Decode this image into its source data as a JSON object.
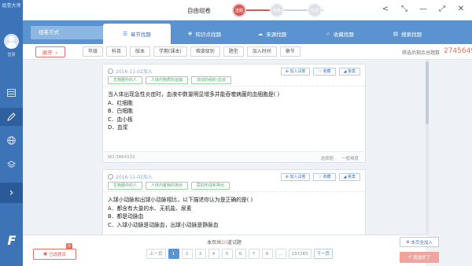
{
  "sidebar": {
    "logo_text": "组卷大师",
    "login_label": "登录",
    "brand_glyph": "F"
  },
  "titlebar": {
    "title": "自由组卷",
    "steps": [
      "选题",
      "组卷",
      "完成"
    ]
  },
  "tabbar": {
    "method_label": "组卷方式",
    "tabs": [
      {
        "label": "章节找题",
        "icon": "list-icon"
      },
      {
        "label": "知识点找题",
        "icon": "network-icon"
      },
      {
        "label": "来源找题",
        "icon": "cloud-icon"
      },
      {
        "label": "收藏找题",
        "icon": "star-icon"
      },
      {
        "label": "搜索找题",
        "icon": "document-icon"
      }
    ]
  },
  "filterbar": {
    "expand_label": "展开",
    "filters": [
      "年级",
      "科目",
      "版本",
      "学期(课本)",
      "难度级别",
      "题型",
      "加入时间",
      "章节"
    ],
    "count_label": "筛选后剩余总题数",
    "count_value": "2745649"
  },
  "questions": [
    {
      "date": "2016-11-02加入",
      "tags": [
        "生物圈中的人",
        "人体内物质的运输",
        "流动的组织-血液"
      ],
      "buttons": [
        "加入试卷",
        "收藏",
        "答案"
      ],
      "stem": "当人体出现急性炎症时，血液中数量明显增多并能吞噬病菌的血细胞是(   )",
      "options": [
        "A．红细胞",
        "B．白细胞",
        "C．血小板",
        "D．血浆"
      ],
      "no": "NO:3864122",
      "type": "选择题",
      "difficulty": "一般难度"
    },
    {
      "date": "2016-11-02加入",
      "tags": [
        "生物圈中的人",
        "人体内废物的排出",
        "尿的形成和排出"
      ],
      "buttons": [
        "加入试卷",
        "收藏",
        "答案"
      ],
      "stem": "入球小动脉和出球小动脉相比，以下描述你认为是正确的是(      )",
      "options": [
        "A．都含有大量的水、无机盐、尿素",
        "B．都是动脉血",
        "C．入球小动脉是动脉血，出球小动脉是静脉血"
      ],
      "no": "",
      "type": "",
      "difficulty": ""
    }
  ],
  "bottombar": {
    "selected_label": "已选题目",
    "selected_count": "0",
    "page_info_prefix": "本页共",
    "page_info_count": "20",
    "page_info_suffix": "道试题",
    "prev_label": "上一页",
    "pages": [
      "1",
      "2",
      "3",
      "4",
      "5",
      "6",
      "7",
      "8",
      "...",
      "137283"
    ],
    "next_label": "下一页",
    "add_all_label": "本页全加入",
    "done_label": "我选好了"
  },
  "colors": {
    "primary": "#3d74b8",
    "tabbar": "#5b93d0",
    "accent": "#d85a56",
    "tag": "#5aa868"
  }
}
